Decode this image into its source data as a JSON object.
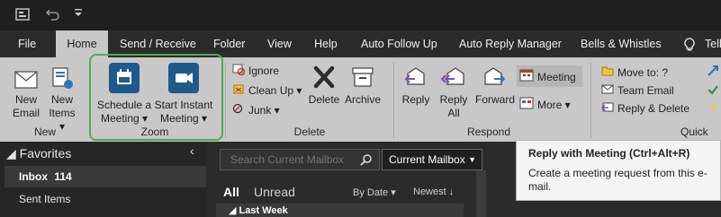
{
  "tabs": [
    "File",
    "Home",
    "Send / Receive",
    "Folder",
    "View",
    "Help",
    "Auto Follow Up",
    "Auto Reply Manager",
    "Bells & Whistles",
    "Tell"
  ],
  "ribbon": {
    "new": {
      "new_email": [
        "New",
        "Email"
      ],
      "new_items": [
        "New",
        "Items ▾"
      ],
      "label": "New"
    },
    "zoom": {
      "schedule": [
        "Schedule a",
        "Meeting ▾"
      ],
      "instant": [
        "Start Instant",
        "Meeting ▾"
      ],
      "label": "Zoom"
    },
    "delete": {
      "ignore": "Ignore",
      "clean_up": "Clean Up ▾",
      "junk": "Junk ▾",
      "delete": "Delete",
      "archive": "Archive",
      "label": "Delete"
    },
    "respond": {
      "reply": "Reply",
      "reply_all": [
        "Reply",
        "All"
      ],
      "forward": "Forward",
      "meeting": "Meeting",
      "more": "More ▾",
      "label": "Respond"
    },
    "quick_steps": {
      "move_to": "Move to: ?",
      "team_email": "Team Email",
      "reply_delete": "Reply & Delete",
      "label": "Quick Ste"
    }
  },
  "nav": {
    "favorites": "◢ Favorites",
    "inbox": "Inbox",
    "inbox_count": "114",
    "sent": "Sent Items"
  },
  "search": {
    "placeholder": "Search Current Mailbox",
    "scope": "Current Mailbox"
  },
  "list": {
    "all": "All",
    "unread": "Unread",
    "sort_by": "By Date ▾",
    "order": "Newest ↓",
    "group": "◢ Last Week"
  },
  "tooltip": {
    "title": "Reply with Meeting (Ctrl+Alt+R)",
    "body": "Create a meeting request from this e-mail."
  },
  "colors": {
    "zoom_blue": "#1f5a8c",
    "zoom_highlight": "#4cae4c",
    "ribbon_bg": "#c8c8c8"
  }
}
